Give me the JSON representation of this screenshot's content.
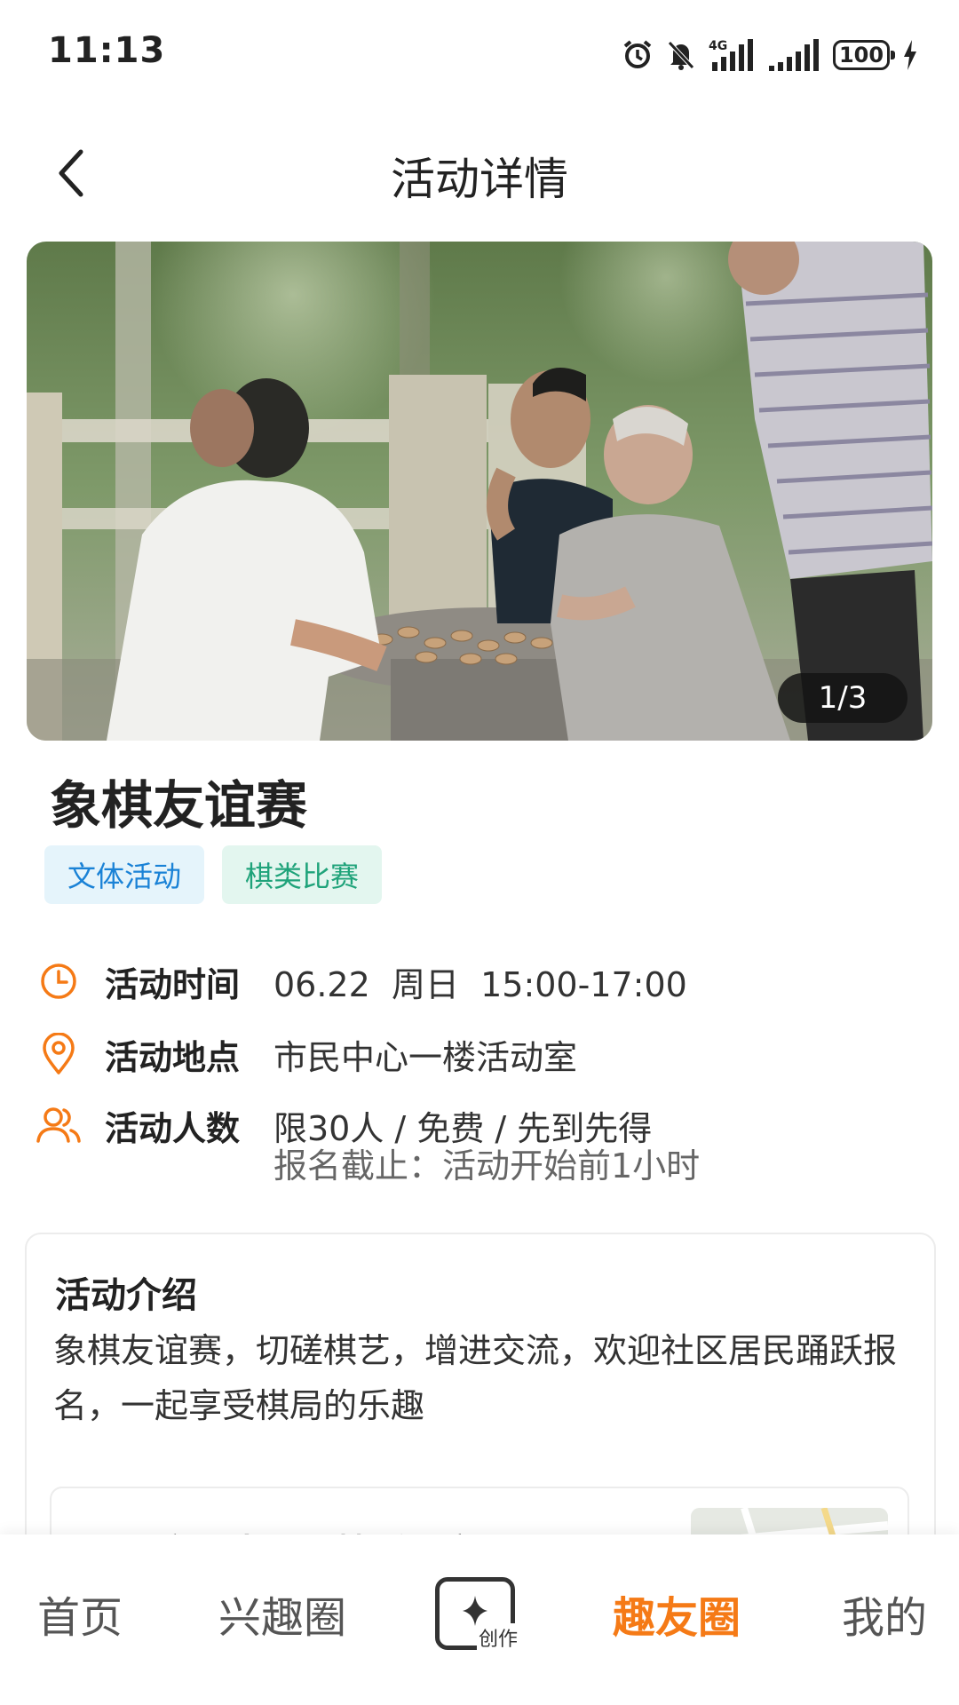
{
  "status_bar": {
    "time": "11:13",
    "network": "4G",
    "battery": "100",
    "icons": [
      "alarm-icon",
      "mute-icon",
      "signal-4g-icon",
      "signal-icon",
      "battery-icon",
      "charging-icon"
    ]
  },
  "header": {
    "title": "活动详情",
    "back_icon": "back-arrow-icon"
  },
  "hero": {
    "image_counter": "1/3"
  },
  "activity": {
    "title": "象棋友谊赛",
    "tags": [
      {
        "label": "文体活动",
        "color": "#1a82d6",
        "bg": "#e5f4fb"
      },
      {
        "label": "棋类比赛",
        "color": "#1fa37a",
        "bg": "#e3f6ef"
      }
    ],
    "time_label": "活动时间",
    "time_value": "06.22  周日  15:00-17:00",
    "location_label": "活动地点",
    "location_value": "市民中心一楼活动室",
    "people_label": "活动人数",
    "people_value": "限30人 / 免费 / 先到先得",
    "deadline": "报名截止：活动开始前1小时",
    "icon_color": "#f57a16"
  },
  "intro": {
    "heading": "活动介绍",
    "text": "象棋友谊赛，切磋棋艺，增进交流，欢迎社区居民踊跃报名，一起享受棋局的乐趣",
    "location_card_name": "市民中心一楼活动室"
  },
  "bottom_nav": {
    "items": [
      {
        "label": "首页"
      },
      {
        "label": "兴趣圈"
      },
      {
        "label": "创作"
      },
      {
        "label": "趣友圈",
        "active": true
      },
      {
        "label": "我的"
      }
    ],
    "accent": "#f57a16"
  }
}
